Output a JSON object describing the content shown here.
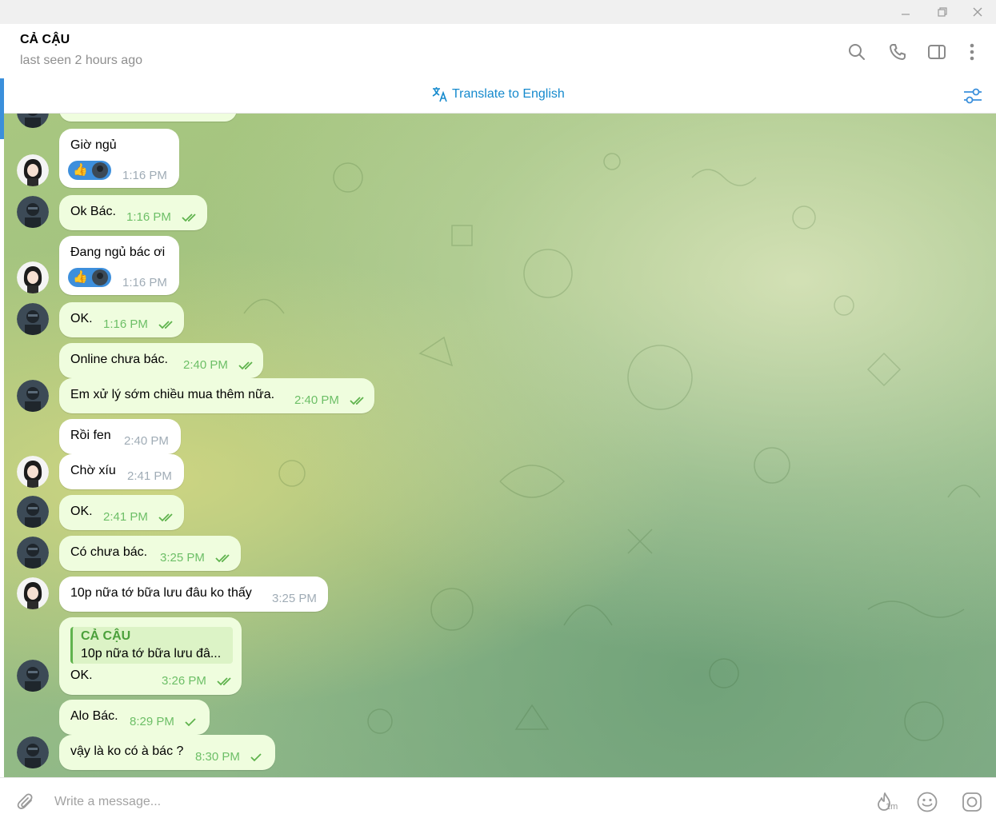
{
  "window": {
    "controls": [
      "minimize",
      "restore",
      "close"
    ]
  },
  "header": {
    "chat_name": "CẢ CẬU",
    "status": "last seen 2 hours ago",
    "icons": [
      "search-icon",
      "phone-icon",
      "sidebar-toggle-icon",
      "more-vertical-icon"
    ]
  },
  "translate_bar": {
    "label": "Translate to English",
    "icon": "translate-icon",
    "settings_icon": "translate-settings-icon"
  },
  "messages": [
    {
      "direction": "in",
      "text": "Giờ ngủ",
      "time": "1:16 PM",
      "reaction": "👍",
      "status": ""
    },
    {
      "direction": "out",
      "text": "Ok Bác.",
      "time": "1:16 PM",
      "status": "read"
    },
    {
      "direction": "in",
      "text": "Đang ngủ bác ơi",
      "time": "1:16 PM",
      "reaction": "👍",
      "status": ""
    },
    {
      "direction": "out",
      "text": "OK.",
      "time": "1:16 PM",
      "status": "read"
    },
    {
      "direction": "out",
      "text": "Online chưa bác.",
      "time": "2:40 PM",
      "status": "read"
    },
    {
      "direction": "out",
      "text": "Em xử lý sớm chiều mua thêm nữa.",
      "time": "2:40 PM",
      "status": "read"
    },
    {
      "direction": "in",
      "text": "Rồi fen",
      "time": "2:40 PM",
      "status": ""
    },
    {
      "direction": "in",
      "text": "Chờ xíu",
      "time": "2:41 PM",
      "status": ""
    },
    {
      "direction": "out",
      "text": "OK.",
      "time": "2:41 PM",
      "status": "read"
    },
    {
      "direction": "out",
      "text": "Có chưa bác.",
      "time": "3:25 PM",
      "status": "read"
    },
    {
      "direction": "in",
      "text": "10p nữa tớ bữa lưu đâu ko thấy",
      "time": "3:25 PM",
      "status": ""
    },
    {
      "direction": "out",
      "text": "OK.",
      "time": "3:26 PM",
      "status": "read",
      "reply_to": {
        "name": "CẢ CẬU",
        "text": "10p nữa tớ bữa lưu đâ..."
      }
    },
    {
      "direction": "out",
      "text": "Alo Bác.",
      "time": "8:29 PM",
      "status": "sent"
    },
    {
      "direction": "out",
      "text": "vậy là ko có à bác ?",
      "time": "8:30 PM",
      "status": "sent"
    }
  ],
  "composer": {
    "placeholder": "Write a message...",
    "icons": [
      "attach-icon",
      "scheduled-1m-icon",
      "emoji-icon",
      "camera-icon"
    ],
    "timer_label": "1m"
  },
  "colors": {
    "accent": "#168acd",
    "outgoing_bubble": "#effdde",
    "incoming_bubble": "#ffffff",
    "outgoing_time": "#6dbf67",
    "incoming_time": "#a0acb6",
    "reply_accent": "#4ba03b"
  }
}
